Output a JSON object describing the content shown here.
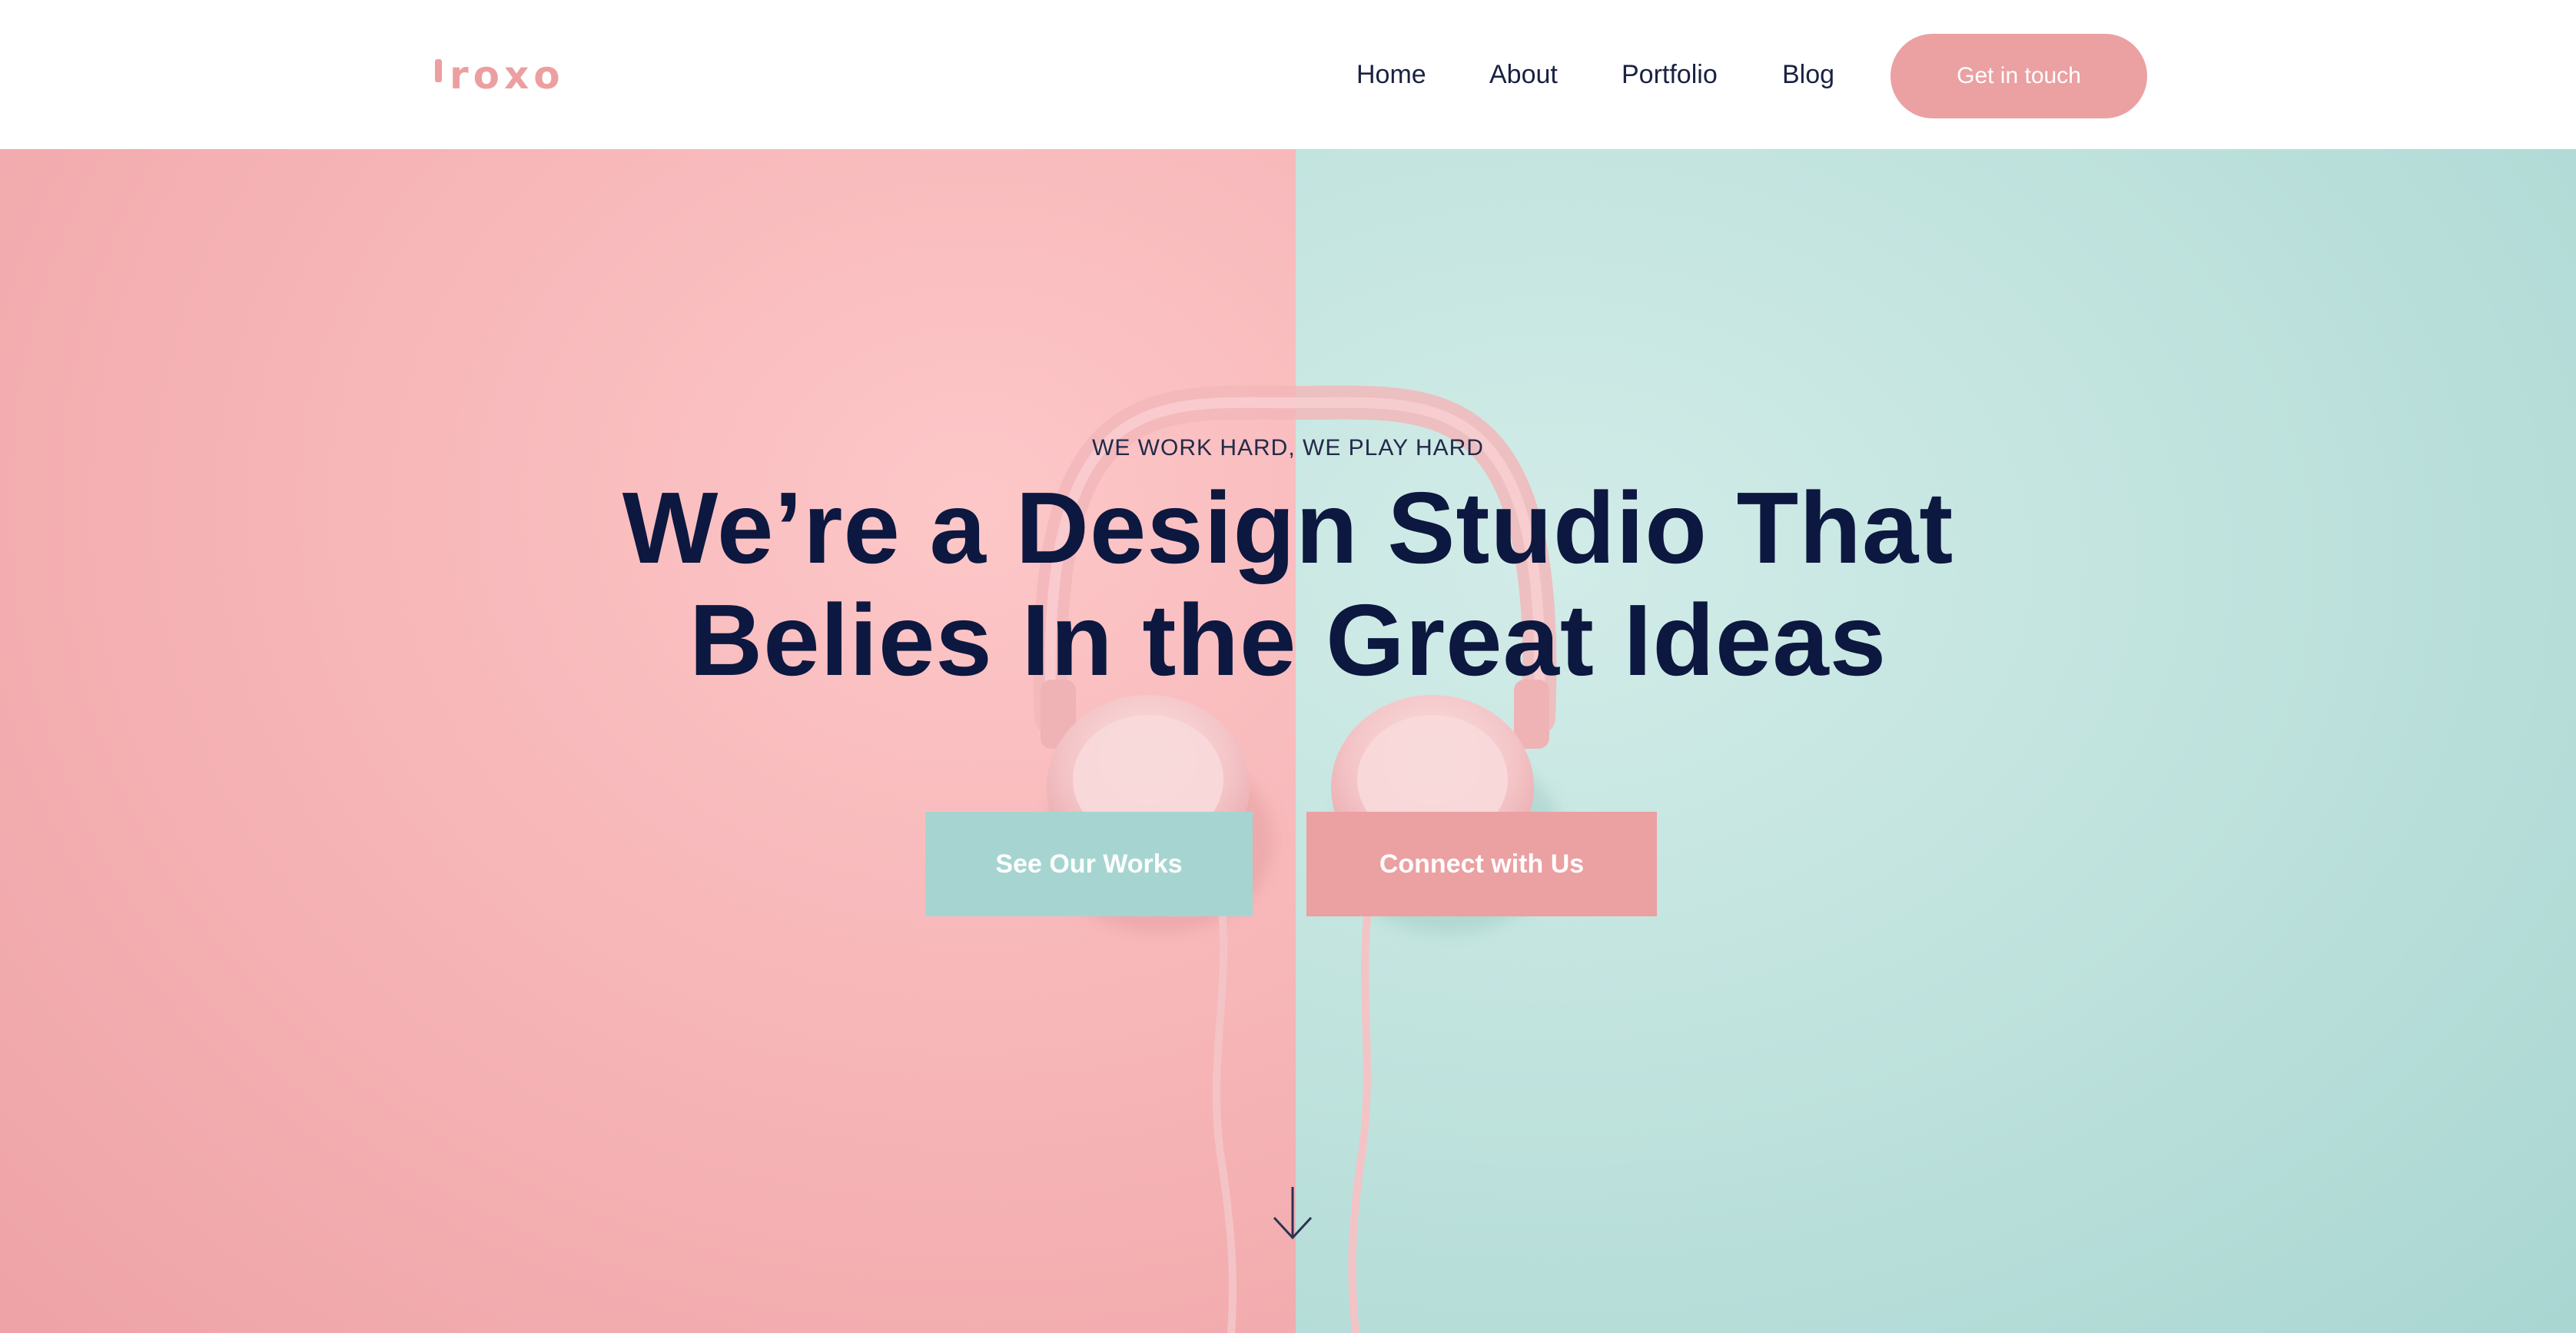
{
  "brand": {
    "logo_text": "roxo",
    "accent_color": "#eba0a2",
    "teal_color": "#a6d5d1",
    "navy_color": "#0c1840"
  },
  "nav": {
    "items": [
      {
        "label": "Home"
      },
      {
        "label": "About"
      },
      {
        "label": "Portfolio"
      },
      {
        "label": "Blog"
      }
    ],
    "cta_label": "Get in touch"
  },
  "hero": {
    "eyebrow": "WE WORK HARD, WE PLAY HARD",
    "headline_line1": "We’re a Design Studio That",
    "headline_line2": "Belies In the Great Ideas",
    "primary_button": "See Our Works",
    "secondary_button": "Connect with Us",
    "scroll_icon": "arrow-down-icon",
    "background_image": "pink-headphones-on-pink-and-mint-background"
  }
}
